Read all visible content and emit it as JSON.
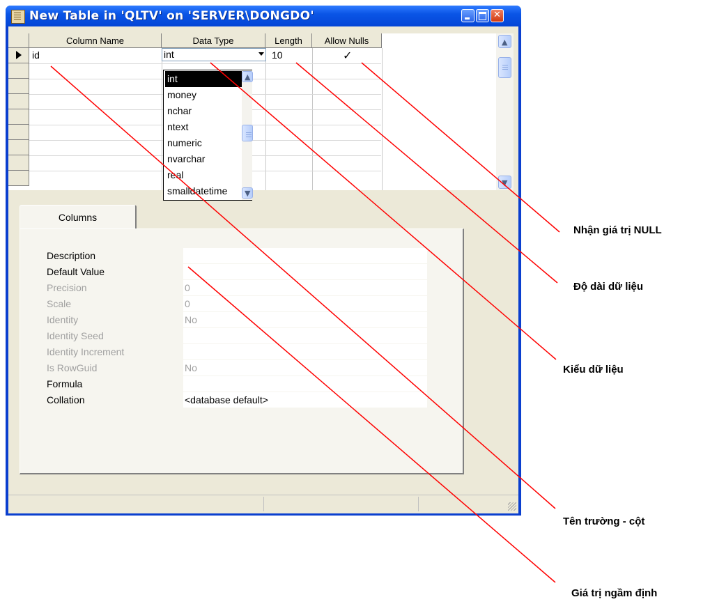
{
  "window": {
    "title": "New Table in 'QLTV' on 'SERVER\\DONGDO'"
  },
  "grid": {
    "headers": [
      "Column Name",
      "Data Type",
      "Length",
      "Allow Nulls"
    ],
    "row": {
      "column_name": "id",
      "data_type": "int",
      "length": "10",
      "allow_nulls": "✓"
    }
  },
  "dropdown": {
    "items": [
      "int",
      "money",
      "nchar",
      "ntext",
      "numeric",
      "nvarchar",
      "real",
      "smalldatetime"
    ],
    "selected": "int"
  },
  "tabs": {
    "columns": "Columns"
  },
  "properties": [
    {
      "label": "Description",
      "value": "",
      "enabled": true
    },
    {
      "label": "Default Value",
      "value": "",
      "enabled": true
    },
    {
      "label": "Precision",
      "value": "0",
      "enabled": false
    },
    {
      "label": "Scale",
      "value": "0",
      "enabled": false
    },
    {
      "label": "Identity",
      "value": "No",
      "enabled": false
    },
    {
      "label": "Identity Seed",
      "value": "",
      "enabled": false
    },
    {
      "label": "Identity Increment",
      "value": "",
      "enabled": false
    },
    {
      "label": "Is RowGuid",
      "value": "No",
      "enabled": false
    },
    {
      "label": "Formula",
      "value": "",
      "enabled": true
    },
    {
      "label": "Collation",
      "value": "<database default>",
      "enabled": true
    }
  ],
  "callouts": {
    "allow_null": "Nhận giá trị NULL",
    "length": "Độ dài dữ liệu",
    "data_type": "Kiểu dữ liệu",
    "column_name": "Tên trường - cột",
    "default_value": "Giá trị ngầm định"
  },
  "colors": {
    "callout_line": "#ff0000",
    "titlebar": "#0a55e6",
    "window_bg": "#ece9d8"
  },
  "icons": {
    "title": "table-designer-icon",
    "minimize": "minimize-icon",
    "maximize": "maximize-icon",
    "close": "close-icon"
  }
}
